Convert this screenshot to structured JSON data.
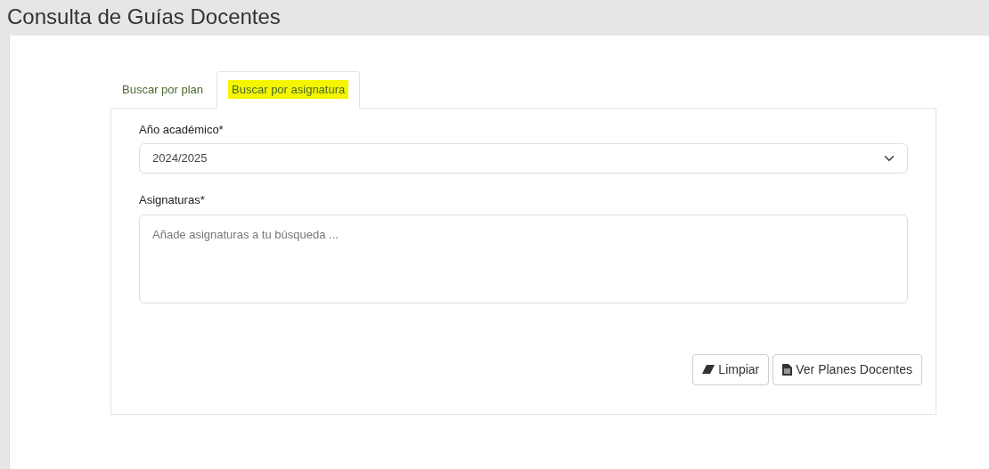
{
  "page": {
    "title": "Consulta de Guías Docentes"
  },
  "tabs": [
    {
      "label": "Buscar por plan",
      "selected": false,
      "highlighted": false
    },
    {
      "label": "Buscar por asignatura",
      "selected": true,
      "highlighted": true
    }
  ],
  "form": {
    "year": {
      "label": "Año académico*",
      "value": "2024/2025"
    },
    "subjects": {
      "label": "Asignaturas*",
      "placeholder": "Añade asignaturas a tu búsqueda ..."
    }
  },
  "buttons": [
    {
      "kind": "clear",
      "label": "Limpiar"
    },
    {
      "kind": "view",
      "label": "Ver Planes Docentes"
    }
  ]
}
